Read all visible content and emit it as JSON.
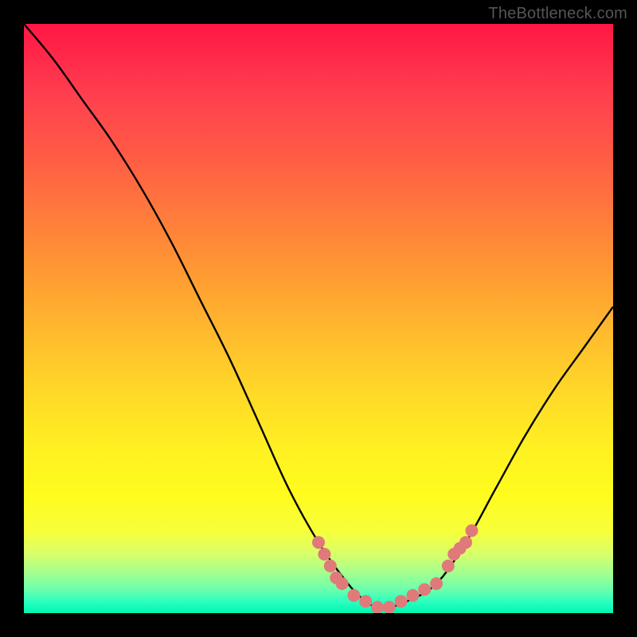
{
  "attribution": "TheBottleneck.com",
  "chart_data": {
    "type": "line",
    "title": "",
    "xlabel": "",
    "ylabel": "",
    "xlim": [
      0,
      100
    ],
    "ylim": [
      0,
      100
    ],
    "grid": false,
    "series": [
      {
        "name": "bottleneck-curve",
        "color": "#000000",
        "x": [
          0,
          5,
          10,
          15,
          20,
          25,
          30,
          35,
          40,
          45,
          50,
          55,
          58,
          60,
          62,
          65,
          70,
          75,
          80,
          85,
          90,
          95,
          100
        ],
        "y": [
          100,
          94,
          87,
          80,
          72,
          63,
          53,
          43,
          32,
          21,
          12,
          5,
          2,
          1,
          1,
          2,
          5,
          12,
          21,
          30,
          38,
          45,
          52
        ]
      }
    ],
    "markers": {
      "name": "highlight-dots",
      "color": "#e07a7a",
      "radius_px": 8,
      "points": [
        {
          "x": 50,
          "y": 12
        },
        {
          "x": 51,
          "y": 10
        },
        {
          "x": 52,
          "y": 8
        },
        {
          "x": 53,
          "y": 6
        },
        {
          "x": 54,
          "y": 5
        },
        {
          "x": 56,
          "y": 3
        },
        {
          "x": 58,
          "y": 2
        },
        {
          "x": 60,
          "y": 1
        },
        {
          "x": 62,
          "y": 1
        },
        {
          "x": 64,
          "y": 2
        },
        {
          "x": 66,
          "y": 3
        },
        {
          "x": 68,
          "y": 4
        },
        {
          "x": 70,
          "y": 5
        },
        {
          "x": 72,
          "y": 8
        },
        {
          "x": 73,
          "y": 10
        },
        {
          "x": 74,
          "y": 11
        },
        {
          "x": 75,
          "y": 12
        },
        {
          "x": 76,
          "y": 14
        }
      ]
    },
    "background_gradient": {
      "top": "#ff1744",
      "mid": "#fff022",
      "bottom": "#00f5b0"
    }
  }
}
